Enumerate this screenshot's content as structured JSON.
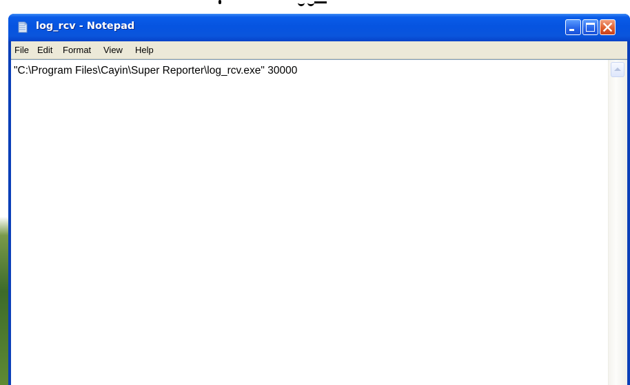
{
  "window": {
    "title": "log_rcv - Notepad",
    "title_color": "#ffffff",
    "titlebar_color": "#0654e0",
    "close_color": "#e0602f"
  },
  "menu": {
    "items": [
      "File",
      "Edit",
      "Format",
      "View",
      "Help"
    ]
  },
  "editor": {
    "content": "\"C:\\Program Files\\Cayin\\Super Reporter\\log_rcv.exe\" 30000"
  },
  "icons": {
    "app": "notepad-icon",
    "minimize": "minimize-icon",
    "maximize": "maximize-icon",
    "close": "close-icon",
    "scroll_up": "chevron-up-icon"
  }
}
